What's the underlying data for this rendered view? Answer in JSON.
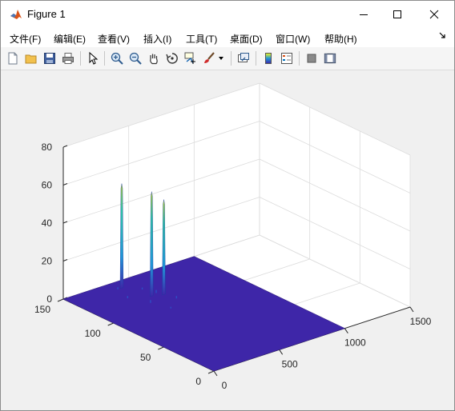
{
  "window": {
    "title": "Figure 1",
    "controls": {
      "minimize": "minimize",
      "maximize": "maximize",
      "close": "close"
    }
  },
  "menu": [
    {
      "label": "文件(F)"
    },
    {
      "label": "编辑(E)"
    },
    {
      "label": "查看(V)"
    },
    {
      "label": "插入(I)"
    },
    {
      "label": "工具(T)"
    },
    {
      "label": "桌面(D)"
    },
    {
      "label": "窗口(W)"
    },
    {
      "label": "帮助(H)"
    }
  ],
  "toolbar": [
    "new-figure-icon",
    "open-folder-icon",
    "save-icon",
    "print-icon",
    "pointer-icon",
    "zoom-in-icon",
    "zoom-out-icon",
    "pan-hand-icon",
    "rotate-3d-icon",
    "data-cursor-icon",
    "brush-icon",
    "link-plot-icon",
    "colorbar-icon",
    "legend-icon",
    "hide-plot-tools-icon",
    "show-plot-tools-icon"
  ],
  "colors": {
    "surface_base": "#3e26a8",
    "peak_mid": "#1f96d8",
    "peak_high": "#2dc5a3",
    "peak_top": "#b7cf36",
    "axis": "#262626",
    "grid": "#dcdcdc"
  },
  "chart_data": {
    "type": "surface",
    "title": "",
    "xlabel": "",
    "ylabel": "",
    "zlabel": "",
    "xlim": [
      0,
      1500
    ],
    "ylim": [
      0,
      150
    ],
    "zlim": [
      0,
      80
    ],
    "x_ticks": [
      "0",
      "500",
      "1000",
      "1500"
    ],
    "y_ticks": [
      "0",
      "50",
      "100",
      "150"
    ],
    "z_ticks": [
      "0",
      "20",
      "40",
      "60",
      "80"
    ],
    "surface_extent": {
      "x": [
        0,
        1000
      ],
      "y": [
        0,
        150
      ]
    },
    "baseline_z": 0,
    "peaks": [
      {
        "x": 370,
        "y": 140,
        "z": 55
      },
      {
        "x": 430,
        "y": 118,
        "z": 55
      },
      {
        "x": 500,
        "y": 115,
        "z": 50
      }
    ],
    "grid": true,
    "box": false
  }
}
